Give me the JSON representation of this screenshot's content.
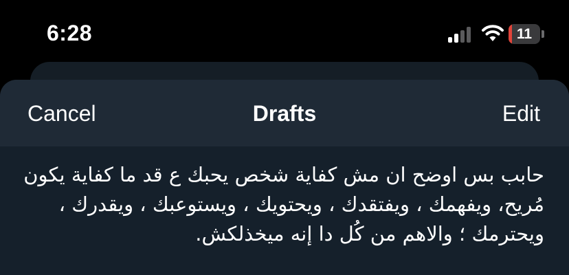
{
  "status_bar": {
    "time": "6:28",
    "battery_percent": "11",
    "battery_level": 0.11,
    "signal_icon": "cellular-signal-icon",
    "wifi_icon": "wifi-icon",
    "battery_icon": "battery-icon"
  },
  "colors": {
    "background": "#000000",
    "sheet": "#15202b",
    "nav_bar": "#1f2a36",
    "battery_low": "#e0443a",
    "text": "#ffffff"
  },
  "drafts_sheet": {
    "cancel_label": "Cancel",
    "title": "Drafts",
    "edit_label": "Edit",
    "items": [
      {
        "text": "حابب بس اوضح ان مش كفاية شخص يحبك ع قد ما كفاية يكون مُريح، ويفهمك ، ويفتقدك ، ويحتويك ، ويستوعبك ، ويقدرك ، ويحترمك ؛ والاهم من كُل دا إنه ميخذلكش."
      }
    ]
  }
}
